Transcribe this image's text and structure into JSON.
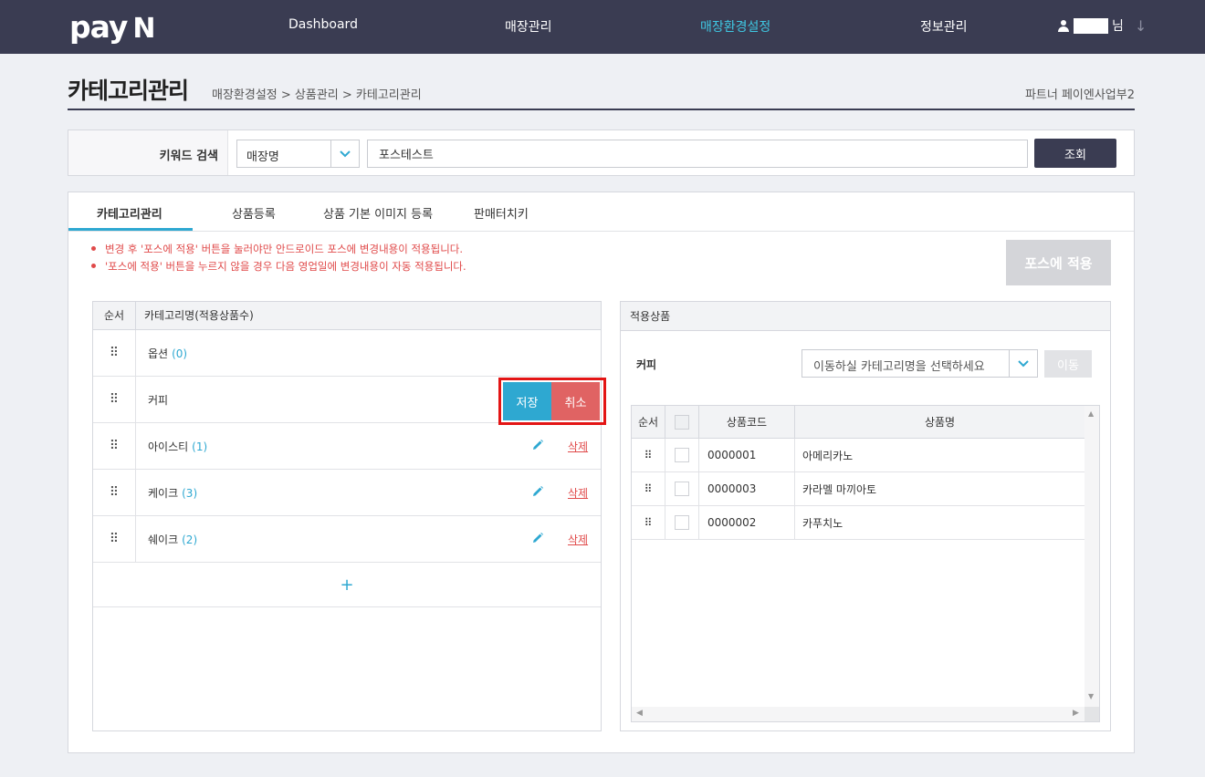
{
  "header": {
    "logo_main": "pay",
    "logo_n": "N",
    "nav": [
      "Dashboard",
      "매장관리",
      "매장환경설정",
      "정보관리"
    ],
    "active_nav": "매장환경설정",
    "user_suffix": "님",
    "user_menu_icon": "down-arrow-icon"
  },
  "page": {
    "title": "카테고리관리",
    "breadcrumb": "매장환경설정 > 상품관리 > 카테고리관리",
    "partner": "파트너 페이엔사업부2"
  },
  "search": {
    "label": "키워드 검색",
    "field_selected": "매장명",
    "keyword_value": "포스테스트",
    "button": "조회"
  },
  "tabs": [
    {
      "label": "카테고리관리",
      "active": true
    },
    {
      "label": "상품등록",
      "active": false
    },
    {
      "label": "상품 기본 이미지 등록",
      "active": false
    },
    {
      "label": "판매터치키",
      "active": false
    }
  ],
  "notices": [
    "변경 후 '포스에 적용' 버튼을 눌러야만 안드로이드 포스에 변경내용이 적용됩니다.",
    "'포스에 적용' 버튼을 누르지 않을 경우 다음 영업일에 변경내용이 자동 적용됩니다."
  ],
  "apply_button": "포스에 적용",
  "category_table": {
    "col_order": "순서",
    "col_name": "카테고리명(적용상품수)",
    "rows": [
      {
        "name": "옵션",
        "count": "(0)",
        "edit": false,
        "delete": ""
      },
      {
        "name": "커피",
        "count": "",
        "edit": false,
        "delete": "",
        "editing": true
      },
      {
        "name": "아이스티",
        "count": "(1)",
        "edit": true,
        "delete": "삭제"
      },
      {
        "name": "케이크",
        "count": "(3)",
        "edit": true,
        "delete": "삭제"
      },
      {
        "name": "쉐이크",
        "count": "(2)",
        "edit": true,
        "delete": "삭제"
      }
    ],
    "add_symbol": "+",
    "save_label": "저장",
    "cancel_label": "취소"
  },
  "applied_products": {
    "title": "적용상품",
    "current_category": "커피",
    "move_placeholder": "이동하실 카테고리명을 선택하세요",
    "move_button": "이동",
    "columns": [
      "순서",
      "",
      "상품코드",
      "상품명"
    ],
    "rows": [
      {
        "code": "0000001",
        "name": "아메리카노"
      },
      {
        "code": "0000003",
        "name": "카라멜 마끼아토"
      },
      {
        "code": "0000002",
        "name": "카푸치노"
      }
    ]
  },
  "colors": {
    "nav_bg": "#3a3c52",
    "accent": "#2ea8d1",
    "active_nav": "#3fc7e2",
    "danger": "#e04a4a",
    "highlight_border": "#e31515"
  }
}
